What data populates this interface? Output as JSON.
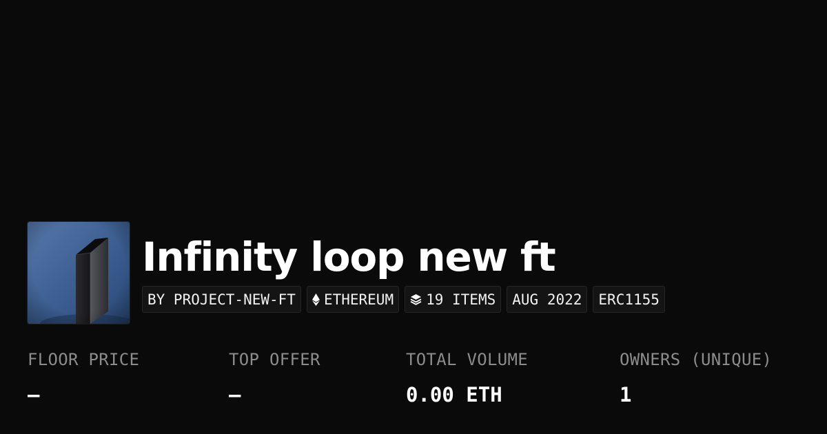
{
  "collection": {
    "title": "Infinity loop new ft",
    "thumbnail_icon": "collection-thumbnail-image",
    "tags": {
      "creator": "BY PROJECT-NEW-FT",
      "chain": "ETHEREUM",
      "chain_icon": "ethereum-icon",
      "items": "19 ITEMS",
      "items_icon": "layers-icon",
      "created": "AUG 2022",
      "standard": "ERC1155"
    }
  },
  "stats": {
    "floor_price": {
      "label": "FLOOR PRICE",
      "value": "—"
    },
    "top_offer": {
      "label": "TOP OFFER",
      "value": "—"
    },
    "total_volume": {
      "label": "TOTAL VOLUME",
      "value": "0.00 ETH"
    },
    "owners": {
      "label": "OWNERS (UNIQUE)",
      "value": "1"
    }
  },
  "colors": {
    "background": "#0a0a0a",
    "text": "#ffffff",
    "muted": "#8c8c8c",
    "tag_background": "#141414",
    "tag_border": "#262626"
  }
}
